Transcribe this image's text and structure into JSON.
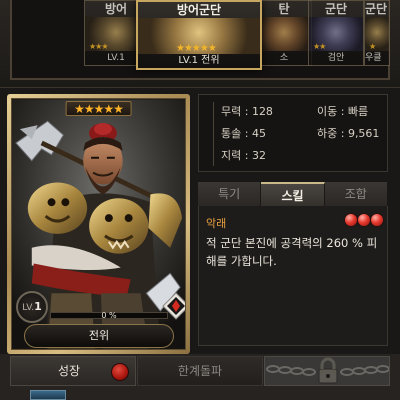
{
  "carousel": {
    "cards": [
      {
        "title": "방어",
        "stars": "★★★",
        "bottom": "LV.1"
      },
      {
        "title": "방어군단",
        "stars": "★★★★★",
        "bottom": "LV.1 전위"
      },
      {
        "title": "탄",
        "stars": "",
        "bottom": "소"
      },
      {
        "title": "군단",
        "stars": "★★",
        "bottom": "검안"
      },
      {
        "title": "군단",
        "stars": "★",
        "bottom": "우클"
      }
    ]
  },
  "hero": {
    "stars": "★★★★★",
    "level_prefix": "LV.",
    "level": "1",
    "exp_percent_text": "0 %",
    "exp_fraction": 0,
    "rank_label": "전위"
  },
  "stats": {
    "force": "무력 : 128",
    "command": "통솔 : 45",
    "intellect": "지력 : 32",
    "movement": "이동 : 빠름",
    "weight": "하중 : 9,561"
  },
  "tabs": [
    "특기",
    "스킬",
    "조합"
  ],
  "active_tab": 1,
  "skill": {
    "name": "악래",
    "description": "적 군단 본진에 공격력의 260 % 피해를 가합니다.",
    "gem_count": 3
  },
  "bottom": {
    "growth_label": "성장",
    "limit_break_label": "한계돌파"
  },
  "colors": {
    "accent_gold": "#c8a860",
    "star": "#ffb428",
    "skill_name": "#e8a040",
    "gem_red": "#e83a2e",
    "background": "#1a1816"
  },
  "icons": {
    "grade_badge": "red-diamond-grade-icon",
    "notification": "red-dot-icon",
    "locked_chain": "chain-lock-icon"
  }
}
